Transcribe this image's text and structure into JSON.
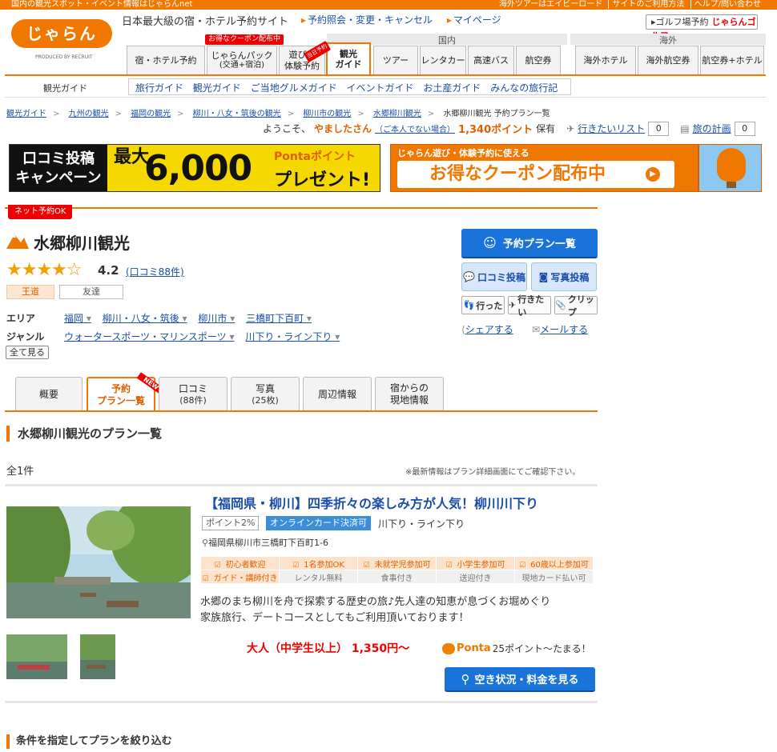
{
  "topbar": {
    "left": "国内の観光スポット・イベント情報はじゃらんnet",
    "links": [
      "海外ツアーはエイビーロード",
      "サイトのご利用方法",
      "ヘルプ/問い合わせ"
    ]
  },
  "header": {
    "logo": "じゃらん",
    "logo_sub": "PRODUCED BY RECRUIT",
    "tagline": "日本最大級の宿・ホテル予約サイト",
    "links": [
      "予約照会・変更・キャンセル",
      "マイページ"
    ],
    "golf": "ゴルフ場予約",
    "golf_brand": "じゃらんゴルフ",
    "coupon_badge": "お得なクーポン配布中",
    "domestic_label": "国内",
    "overseas_label": "海外",
    "tabs": [
      "宿・ホテル予約",
      "じゃらんパック",
      "(交通+宿泊)",
      "遊び・",
      "体験予約",
      "観光",
      "ガイド",
      "ツアー",
      "レンタカー",
      "高速バス",
      "航空券"
    ],
    "overseas_tabs": [
      "海外ホテル",
      "海外航空券",
      "航空券+ホテル"
    ],
    "new_badge": "当日予約"
  },
  "subnav": {
    "label": "観光ガイド",
    "items": [
      "旅行ガイド",
      "観光ガイド",
      "ご当地グルメガイド",
      "イベントガイド",
      "お土産ガイド",
      "みんなの旅行記"
    ]
  },
  "breadcrumb": [
    "観光ガイド",
    "九州の観光",
    "福岡の観光",
    "柳川・八女・筑後の観光",
    "柳川市の観光",
    "水郷柳川観光",
    "水郷柳川観光 予約プラン一覧"
  ],
  "welcome": {
    "prefix": "ようこそ、",
    "name": "やましたさん",
    "not_you": "（ご本人でない場合）",
    "points": "1,340ポイント",
    "points_suffix": "保有",
    "wishlist": "行きたいリスト",
    "wishlist_count": "0",
    "plan": "旅の計画",
    "plan_count": "0"
  },
  "banners": {
    "b1_left": [
      "口コミ投稿",
      "キャンペーン"
    ],
    "b1_max": "最大",
    "b1_amount": "6,000",
    "b1_ponta": "Pontaポイント",
    "b1_present": "プレゼント!",
    "b2_top": "じゃらん遊び・体験予約に使える",
    "b2_main": "お得なクーポン配布中"
  },
  "spot": {
    "net_ok": "ネット予約OK",
    "name": "水郷柳川観光",
    "stars": "★★★★☆",
    "rating": "4.2",
    "reviews": "(口コミ88件)",
    "tag1": "王道",
    "tag2": "友達",
    "area_label": "エリア",
    "area": [
      "福岡",
      "柳川・八女・筑後",
      "柳川市",
      "三橋町下百町"
    ],
    "genre_label": "ジャンル",
    "genre": [
      "ウォータースポーツ・マリンスポーツ",
      "川下り・ライン下り"
    ],
    "see_all": "全て見る"
  },
  "actions": {
    "plan_list": "予約プラン一覧",
    "review_post": "口コミ投稿",
    "photo_post": "写真投稿",
    "went": "行った",
    "want": "行きたい",
    "clip": "クリップ",
    "share": "シェアする",
    "mail": "メールする"
  },
  "tabs": [
    {
      "l1": "概要",
      "l2": ""
    },
    {
      "l1": "予約",
      "l2": "プラン一覧"
    },
    {
      "l1": "口コミ",
      "l2": "(88件)"
    },
    {
      "l1": "写真",
      "l2": "(25枚)"
    },
    {
      "l1": "周辺情報",
      "l2": ""
    },
    {
      "l1": "宿からの",
      "l2": "現地情報"
    }
  ],
  "new_label": "NEW",
  "section": {
    "title": "水郷柳川観光のプラン一覧",
    "total": "全1件",
    "note": "※最新情報はプラン詳細画面にてご確認下さい。"
  },
  "plan": {
    "title": "【福岡県・柳川】四季折々の楽しみ方が人気！柳川川下り",
    "chip_point": "ポイント2%",
    "chip_card": "オンラインカード決済可",
    "category": "川下り・ライン下り",
    "address": "福岡県柳川市三橋町下百町1-6",
    "features_row1": [
      "初心者歓迎",
      "1名参加OK",
      "未就学児参加可",
      "小学生参加可",
      "60歳以上参加可"
    ],
    "features_row2": [
      "ガイド・講師付き",
      "レンタル無料",
      "食事付き",
      "送迎付き",
      "現地カード払い可"
    ],
    "desc1": "水郷のまち柳川を舟で探索する歴史の旅♪先人達の知恵が息づくお堀めぐり",
    "desc2": "家族旅行、デートコースとしてもご利用頂いております！",
    "price": "大人（中学生以上） 1,350円～",
    "ponta_word": "Ponta",
    "ponta_text": "25ポイント～たまる！",
    "avail": "空き状況・料金を見る"
  },
  "filter_title": "条件を指定してプランを絞り込む"
}
